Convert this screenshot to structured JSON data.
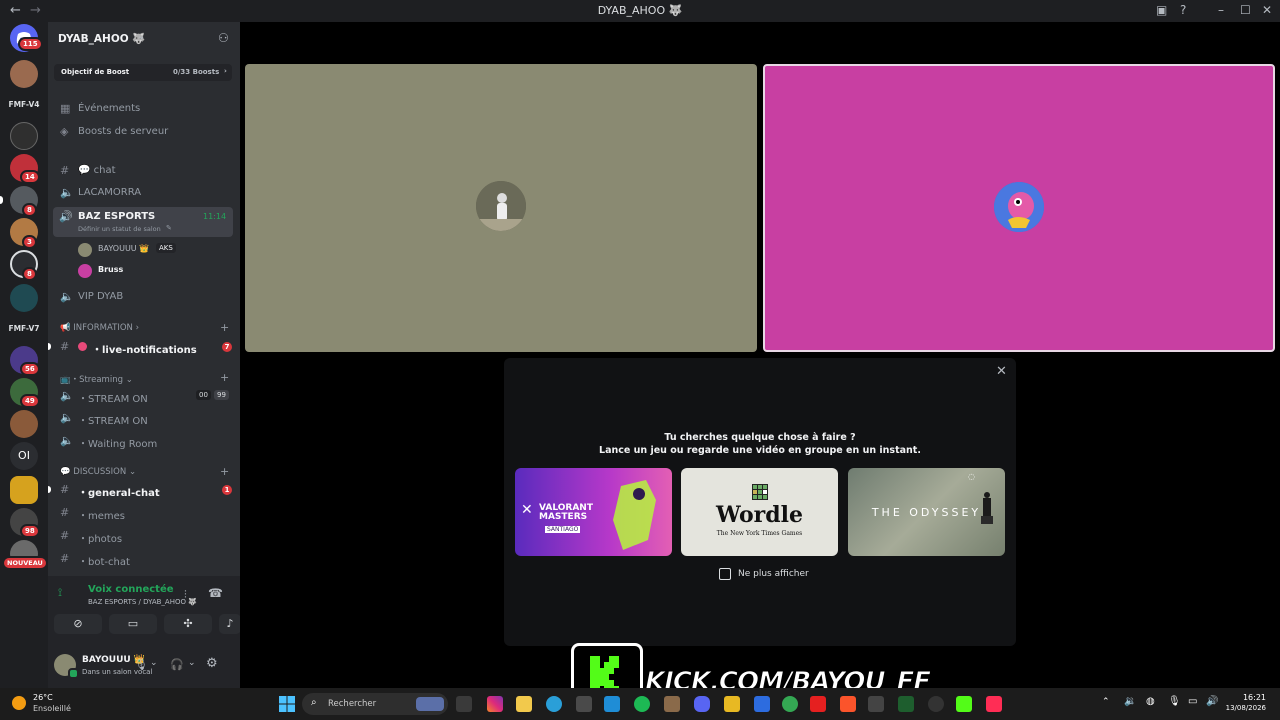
{
  "window": {
    "title": "DYAB_AHOO 🐺"
  },
  "guilds": {
    "home_badge": "115",
    "items": [
      {
        "label": "FMF-V4"
      },
      {
        "label": "FMF-V7"
      },
      {
        "label": "OI"
      }
    ],
    "badges": [
      "14",
      "8",
      "3",
      "8",
      "56",
      "49",
      "98"
    ],
    "new_badge": "NOUVEAU"
  },
  "server": {
    "name": "DYAB_AHOO 🐺",
    "boost_label": "Objectif de Boost",
    "boost_count": "0/33 Boosts"
  },
  "channels": {
    "events": "Événements",
    "server_boosts": "Boosts de serveur",
    "chat": "💬 chat",
    "lacamorra": "LACAMORRA",
    "baz_esports": "BAZ ESPORTS",
    "baz_time": "11:14",
    "baz_status": "Définir un statut de salon",
    "voice_users": [
      {
        "name": "BAYOUUU 👑",
        "tag": "AKS"
      },
      {
        "name": "Bruss",
        "tag": ""
      }
    ],
    "vip": "VIP DYAB",
    "cat_information": "📢 INFORMATION",
    "live_notifications": "・live-notifications",
    "live_badge": "7",
    "cat_streaming": "📺・Streaming",
    "stream_on_1": "・STREAM ON",
    "stream_on_1_counts": [
      "00",
      "99"
    ],
    "stream_on_2": "・STREAM ON",
    "waiting_room": "・Waiting Room",
    "cat_discussion": "💬 DISCUSSION",
    "general_chat": "・general-chat",
    "general_badge": "1",
    "memes": "・memes",
    "photos": "・photos",
    "bot_chat": "・bot-chat"
  },
  "voice_panel": {
    "status": "Voix connectée",
    "location": "BAZ ESPORTS / DYAB_AHOO 🐺"
  },
  "user": {
    "name": "BAYOUUU 👑",
    "status": "Dans un salon vocal"
  },
  "activity": {
    "title": "Tu cherches quelque chose à faire ?",
    "subtitle": "Lance un jeu ou regarde une vidéo en groupe en un instant.",
    "cards": [
      {
        "title": "VALORANT MASTERS",
        "sub": "SANTIAGO"
      },
      {
        "title": "Wordle",
        "sub": "The New York Times Games"
      },
      {
        "title": "THE ODYSSEY",
        "sub": ""
      }
    ],
    "checkbox_label": "Ne plus afficher"
  },
  "overlay": {
    "kick_text": "KICK.COM/BAYOU_FF"
  },
  "taskbar": {
    "weather_temp": "26°C",
    "weather_desc": "Ensoleillé",
    "search_placeholder": "Rechercher",
    "time": "16:21",
    "date": "13/08/2026"
  },
  "colors": {
    "tile_left": "#8a8a72",
    "tile_right": "#c83fa2",
    "accent_green": "#23a55a",
    "danger_red": "#da373c"
  }
}
